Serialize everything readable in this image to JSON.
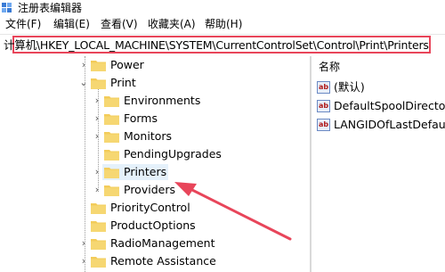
{
  "window": {
    "title": "注册表编辑器"
  },
  "menu": [
    {
      "label": "文件(F)"
    },
    {
      "label": "编辑(E)"
    },
    {
      "label": "查看(V)"
    },
    {
      "label": "收藏夹(A)"
    },
    {
      "label": "帮助(H)"
    }
  ],
  "address": {
    "path": "计算机\\HKEY_LOCAL_MACHINE\\SYSTEM\\CurrentControlSet\\Control\\Print\\Printers"
  },
  "tree": {
    "items": [
      {
        "label": "Power"
      },
      {
        "label": "Print"
      },
      {
        "label": "Environments"
      },
      {
        "label": "Forms"
      },
      {
        "label": "Monitors"
      },
      {
        "label": "PendingUpgrades"
      },
      {
        "label": "Printers"
      },
      {
        "label": "Providers"
      },
      {
        "label": "PriorityControl"
      },
      {
        "label": "ProductOptions"
      },
      {
        "label": "RadioManagement"
      },
      {
        "label": "Remote Assistance"
      }
    ]
  },
  "values_pane": {
    "header": "名称",
    "rows": [
      {
        "name": "(默认)",
        "icon": "string-value-icon"
      },
      {
        "name": "DefaultSpoolDirector",
        "icon": "string-value-icon"
      },
      {
        "name": "LANGIDOfLastDefaul",
        "icon": "string-value-icon"
      }
    ]
  },
  "colors": {
    "highlight": "#e8455a",
    "folder": "#f3cc5a",
    "selection": "#e5f1fb"
  }
}
